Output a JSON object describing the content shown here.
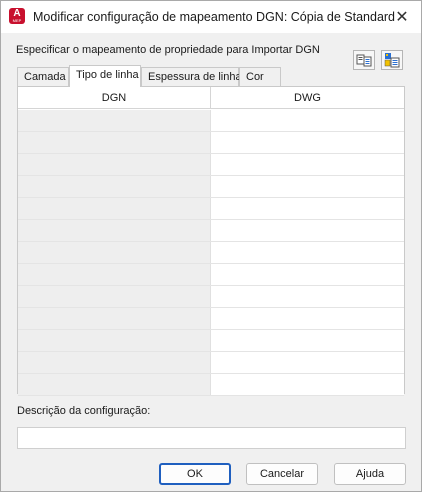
{
  "window": {
    "title": "Modificar configuração de mapeamento DGN: Cópia de Standard",
    "app_icon_letter": "A",
    "app_icon_sub": "MEP",
    "close_glyph": "✕"
  },
  "instruction": "Especificar o mapeamento de propriedade para Importar DGN",
  "toolbar": {
    "icons": [
      "dgn-to-dwg-map-icon",
      "layer-map-icon"
    ]
  },
  "tabs": [
    {
      "label": "Camada",
      "active": false
    },
    {
      "label": "Tipo de linha",
      "active": true
    },
    {
      "label": "Espessura de linha",
      "active": false
    },
    {
      "label": "Cor",
      "active": false
    }
  ],
  "grid": {
    "columns": [
      "DGN",
      "DWG"
    ],
    "rows": [
      [
        "",
        ""
      ],
      [
        "",
        ""
      ],
      [
        "",
        ""
      ],
      [
        "",
        ""
      ],
      [
        "",
        ""
      ],
      [
        "",
        ""
      ],
      [
        "",
        ""
      ],
      [
        "",
        ""
      ],
      [
        "",
        ""
      ],
      [
        "",
        ""
      ],
      [
        "",
        ""
      ],
      [
        "",
        ""
      ],
      [
        "",
        ""
      ]
    ]
  },
  "description": {
    "label": "Descrição da configuração:",
    "value": ""
  },
  "buttons": {
    "ok": "OK",
    "cancel": "Cancelar",
    "help": "Ajuda"
  },
  "colors": {
    "app_icon": "#c8102e",
    "default_button_border": "#1f5fbf",
    "dgn_column_bg": "#eeeeee"
  }
}
